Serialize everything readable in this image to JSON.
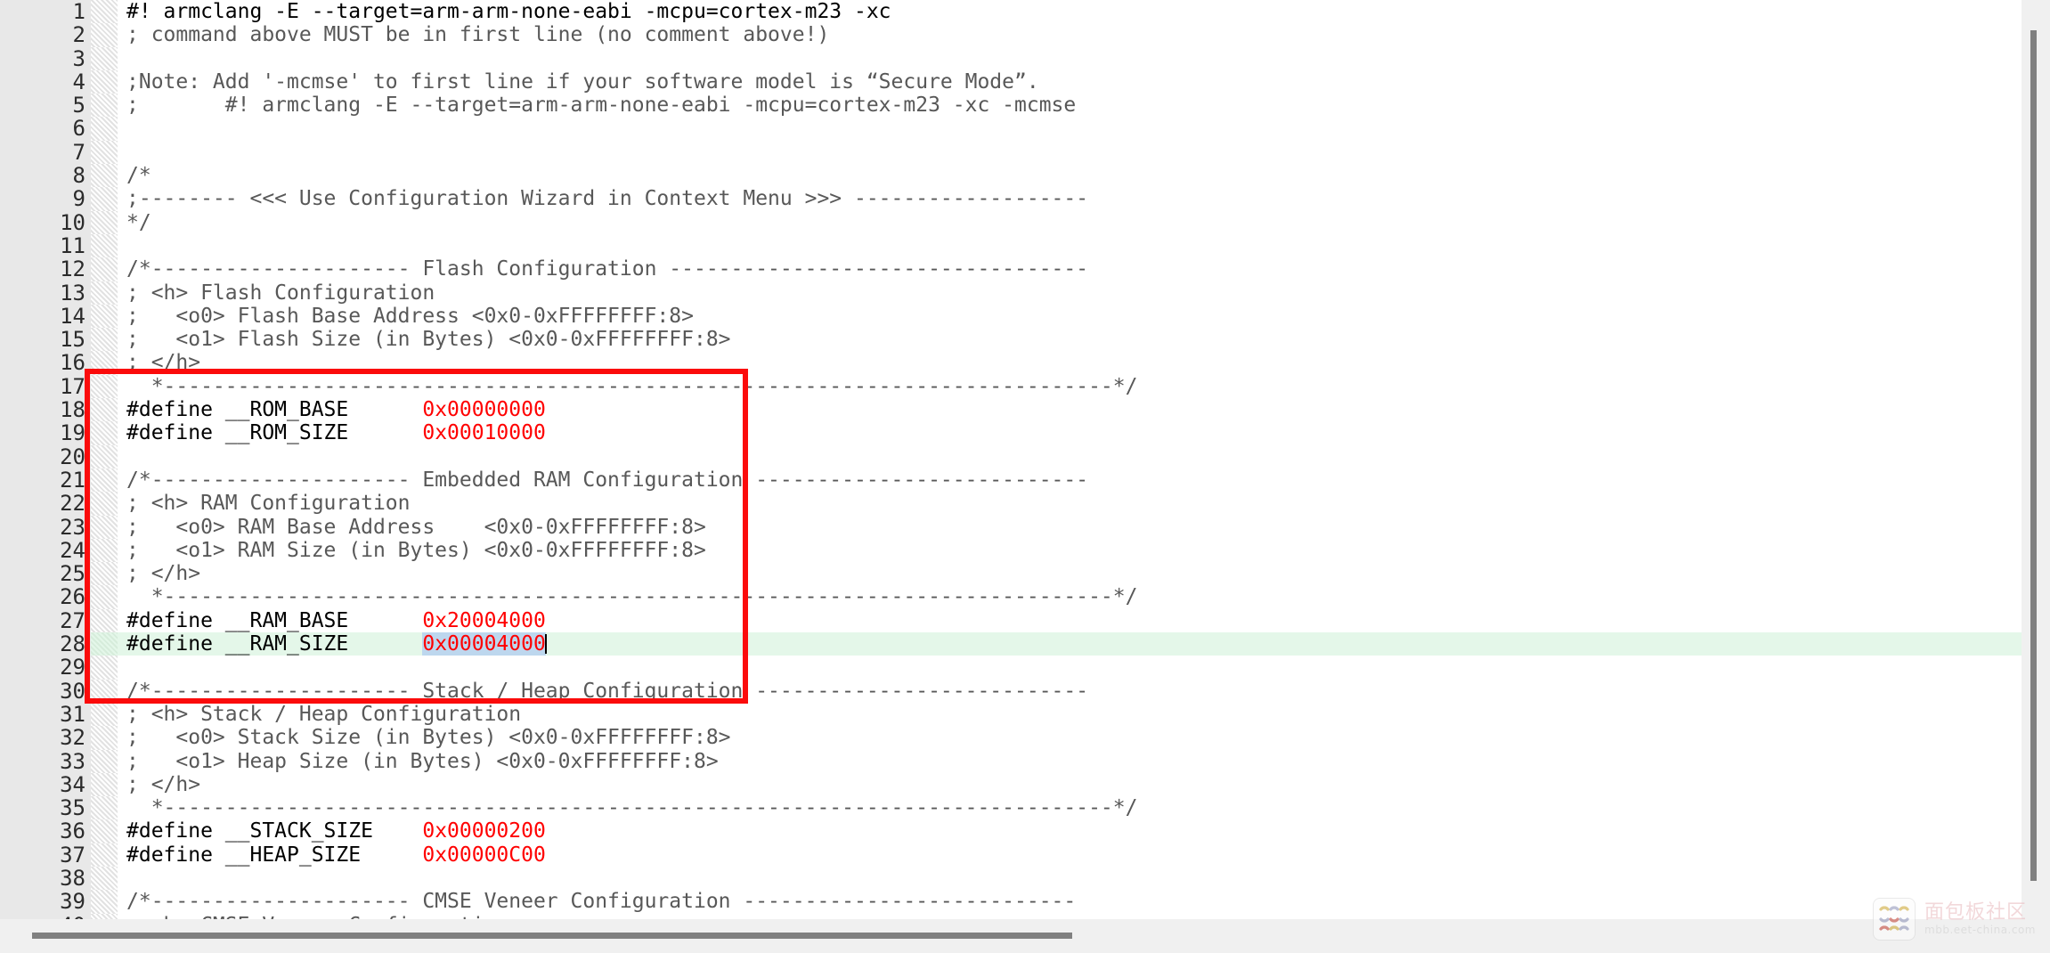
{
  "editor": {
    "file_type": "keil-scatter-config-header",
    "selection_text": "0x00004000",
    "current_line": 28,
    "lines": [
      {
        "n": "1",
        "segs": [
          {
            "t": "#! armclang -E --target=arm-arm-none-eabi -mcpu=cortex-m23 -xc",
            "c": "plain"
          }
        ]
      },
      {
        "n": "2",
        "segs": [
          {
            "t": "; command above MUST be in first line (no comment above!)",
            "c": "comment"
          }
        ]
      },
      {
        "n": "3",
        "segs": [
          {
            "t": "",
            "c": "plain"
          }
        ]
      },
      {
        "n": "4",
        "segs": [
          {
            "t": ";Note: Add '-mcmse' to first line if your software model is “Secure Mode”.",
            "c": "comment"
          }
        ]
      },
      {
        "n": "5",
        "segs": [
          {
            "t": ";       #! armclang -E --target=arm-arm-none-eabi -mcpu=cortex-m23 -xc -mcmse",
            "c": "comment"
          }
        ]
      },
      {
        "n": "6",
        "segs": [
          {
            "t": "",
            "c": "plain"
          }
        ]
      },
      {
        "n": "7",
        "segs": [
          {
            "t": "",
            "c": "plain"
          }
        ]
      },
      {
        "n": "8",
        "segs": [
          {
            "t": "/*",
            "c": "comment"
          }
        ]
      },
      {
        "n": "9",
        "segs": [
          {
            "t": ";-------- <<< Use Configuration Wizard in Context Menu >>> -------------------",
            "c": "comment"
          }
        ]
      },
      {
        "n": "10",
        "segs": [
          {
            "t": "*/",
            "c": "comment"
          }
        ]
      },
      {
        "n": "11",
        "segs": [
          {
            "t": "",
            "c": "plain"
          }
        ]
      },
      {
        "n": "12",
        "segs": [
          {
            "t": "/*--------------------- Flash Configuration ----------------------------------",
            "c": "comment"
          }
        ]
      },
      {
        "n": "13",
        "segs": [
          {
            "t": "; <h> Flash Configuration",
            "c": "comment"
          }
        ]
      },
      {
        "n": "14",
        "segs": [
          {
            "t": ";   <o0> Flash Base Address <0x0-0xFFFFFFFF:8>",
            "c": "comment"
          }
        ]
      },
      {
        "n": "15",
        "segs": [
          {
            "t": ";   <o1> Flash Size (in Bytes) <0x0-0xFFFFFFFF:8>",
            "c": "comment"
          }
        ]
      },
      {
        "n": "16",
        "segs": [
          {
            "t": "; </h>",
            "c": "comment"
          }
        ]
      },
      {
        "n": "17",
        "segs": [
          {
            "t": "  *-----------------------------------------------------------------------------*/",
            "c": "comment"
          }
        ]
      },
      {
        "n": "18",
        "segs": [
          {
            "t": "#define __ROM_BASE      ",
            "c": "plain"
          },
          {
            "t": "0x00000000",
            "c": "value"
          }
        ]
      },
      {
        "n": "19",
        "segs": [
          {
            "t": "#define __ROM_SIZE      ",
            "c": "plain"
          },
          {
            "t": "0x00010000",
            "c": "value"
          }
        ]
      },
      {
        "n": "20",
        "segs": [
          {
            "t": "",
            "c": "plain"
          }
        ]
      },
      {
        "n": "21",
        "segs": [
          {
            "t": "/*--------------------- Embedded RAM Configuration ---------------------------",
            "c": "comment"
          }
        ]
      },
      {
        "n": "22",
        "segs": [
          {
            "t": "; <h> RAM Configuration",
            "c": "comment"
          }
        ]
      },
      {
        "n": "23",
        "segs": [
          {
            "t": ";   <o0> RAM Base Address    <0x0-0xFFFFFFFF:8>",
            "c": "comment"
          }
        ]
      },
      {
        "n": "24",
        "segs": [
          {
            "t": ";   <o1> RAM Size (in Bytes) <0x0-0xFFFFFFFF:8>",
            "c": "comment"
          }
        ]
      },
      {
        "n": "25",
        "segs": [
          {
            "t": "; </h>",
            "c": "comment"
          }
        ]
      },
      {
        "n": "26",
        "segs": [
          {
            "t": "  *-----------------------------------------------------------------------------*/",
            "c": "comment"
          }
        ]
      },
      {
        "n": "27",
        "segs": [
          {
            "t": "#define __RAM_BASE      ",
            "c": "plain"
          },
          {
            "t": "0x20004000",
            "c": "value"
          }
        ]
      },
      {
        "n": "28",
        "segs": [
          {
            "t": "#define __RAM_SIZE      ",
            "c": "plain"
          },
          {
            "t": "0x00004000",
            "c": "value",
            "sel": true,
            "caret": true
          }
        ]
      },
      {
        "n": "29",
        "segs": [
          {
            "t": "",
            "c": "plain"
          }
        ]
      },
      {
        "n": "30",
        "segs": [
          {
            "t": "/*--------------------- Stack / Heap Configuration ---------------------------",
            "c": "comment"
          }
        ]
      },
      {
        "n": "31",
        "segs": [
          {
            "t": "; <h> Stack / Heap Configuration",
            "c": "comment"
          }
        ]
      },
      {
        "n": "32",
        "segs": [
          {
            "t": ";   <o0> Stack Size (in Bytes) <0x0-0xFFFFFFFF:8>",
            "c": "comment"
          }
        ]
      },
      {
        "n": "33",
        "segs": [
          {
            "t": ";   <o1> Heap Size (in Bytes) <0x0-0xFFFFFFFF:8>",
            "c": "comment"
          }
        ]
      },
      {
        "n": "34",
        "segs": [
          {
            "t": "; </h>",
            "c": "comment"
          }
        ]
      },
      {
        "n": "35",
        "segs": [
          {
            "t": "  *-----------------------------------------------------------------------------*/",
            "c": "comment"
          }
        ]
      },
      {
        "n": "36",
        "segs": [
          {
            "t": "#define __STACK_SIZE    ",
            "c": "plain"
          },
          {
            "t": "0x00000200",
            "c": "value"
          }
        ]
      },
      {
        "n": "37",
        "segs": [
          {
            "t": "#define __HEAP_SIZE     ",
            "c": "plain"
          },
          {
            "t": "0x00000C00",
            "c": "value"
          }
        ]
      },
      {
        "n": "38",
        "segs": [
          {
            "t": "",
            "c": "plain"
          }
        ]
      },
      {
        "n": "39",
        "segs": [
          {
            "t": "/*--------------------- CMSE Veneer Configuration ---------------------------",
            "c": "comment"
          }
        ]
      },
      {
        "n": "40",
        "segs": [
          {
            "t": "; <h> CMSE Veneer Configuration",
            "c": "comment"
          }
        ]
      }
    ]
  },
  "annotation": {
    "type": "red-rectangle-highlight",
    "color": "#fb0b0b"
  },
  "watermark": {
    "title": "面包板社区",
    "url": "mbb.eet-china.com"
  },
  "colors": {
    "value_red": "#ff0000",
    "comment_gray": "#585858",
    "current_line_green": "#e4f7e9",
    "selection_blue": "#bdd7ee",
    "gutter_gray": "#e8e8e8",
    "annotation_red": "#fb0b0b"
  }
}
